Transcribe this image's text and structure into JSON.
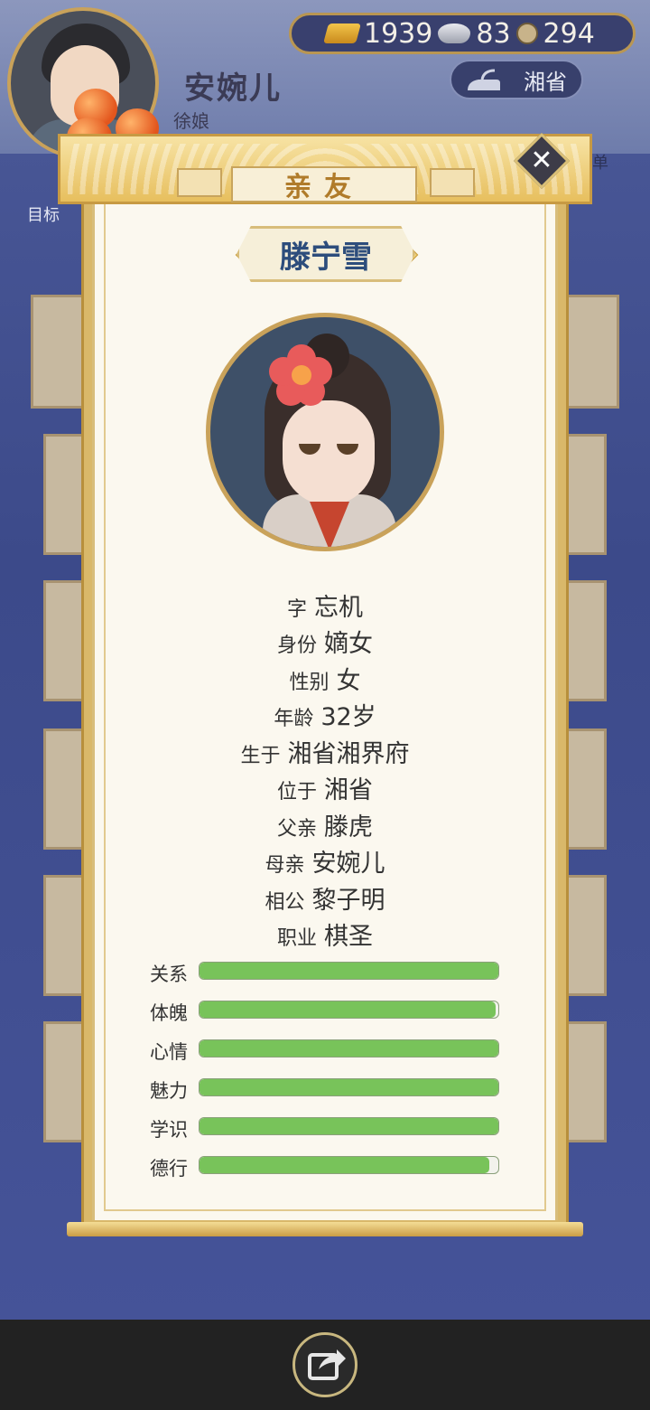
{
  "player": {
    "name": "安婉儿",
    "title": "徐娘",
    "avatar_icon": "player-portrait"
  },
  "currency": {
    "gold": "1939",
    "silver": "83",
    "coins": "294"
  },
  "region": "湘省",
  "hud": {
    "menu_label": "菜单",
    "goal_label": "目标"
  },
  "dialog": {
    "title": "亲友",
    "character_name": "滕宁雪",
    "close_icon": "close-icon"
  },
  "info": [
    {
      "key": "字",
      "value": "忘机"
    },
    {
      "key": "身份",
      "value": "嫡女"
    },
    {
      "key": "性别",
      "value": "女"
    },
    {
      "key": "年龄",
      "value": "32岁"
    },
    {
      "key": "生于",
      "value": "湘省湘界府"
    },
    {
      "key": "位于",
      "value": "湘省"
    },
    {
      "key": "父亲",
      "value": "滕虎"
    },
    {
      "key": "母亲",
      "value": "安婉儿"
    },
    {
      "key": "相公",
      "value": "黎子明"
    },
    {
      "key": "职业",
      "value": "棋圣"
    }
  ],
  "stats": [
    {
      "label": "关系",
      "value": 100
    },
    {
      "label": "体魄",
      "value": 99
    },
    {
      "label": "心情",
      "value": 100
    },
    {
      "label": "魅力",
      "value": 100
    },
    {
      "label": "学识",
      "value": 100
    },
    {
      "label": "德行",
      "value": 97
    }
  ],
  "colors": {
    "stat_fill": "#78c35a",
    "name_color": "#2d4d7c",
    "header_gold": "#e7bf5e"
  },
  "footer": {
    "share_icon": "share-icon"
  }
}
